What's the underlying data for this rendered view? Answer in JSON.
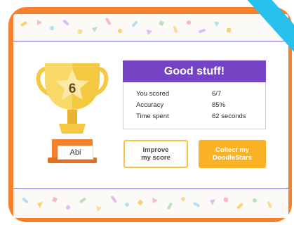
{
  "trophy": {
    "score_badge": "6",
    "player_name": "Abi"
  },
  "result": {
    "title": "Good stuff!",
    "stats": [
      {
        "label": "You scored",
        "value": "6/7"
      },
      {
        "label": "Accuracy",
        "value": "85%"
      },
      {
        "label": "Time spent",
        "value": "62 seconds"
      }
    ]
  },
  "buttons": {
    "improve_label": "Improve\nmy score",
    "collect_label": "Collect my\nDoodleStars"
  },
  "colors": {
    "device_frame": "#f4812e",
    "header_purple": "#7444c4",
    "collect_button": "#fbb124",
    "improve_border": "#f7c44a",
    "ribbon": "#27c1ee",
    "trophy_gold": "#f5c842"
  }
}
